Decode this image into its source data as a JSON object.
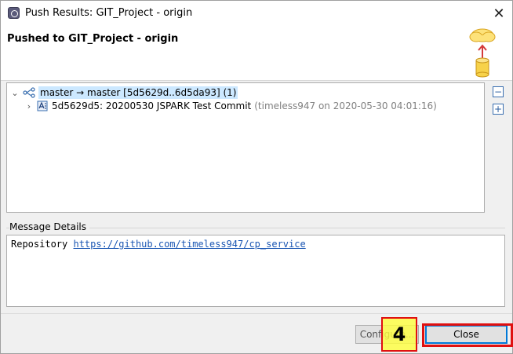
{
  "window": {
    "title": "Push Results: GIT_Project - origin",
    "close_glyph": "✕"
  },
  "header": {
    "title": "Pushed to GIT_Project - origin"
  },
  "tree": {
    "ref_row": {
      "label": "master → master [5d5629d..6d5da93] (1)",
      "expanded": true
    },
    "commit_row": {
      "label": "5d5629d5: 20200530 JSPARK Test Commit",
      "meta": "(timeless947 on 2020-05-30 04:01:16)"
    }
  },
  "side_buttons": {
    "collapse_glyph": "−",
    "expand_glyph": "+"
  },
  "message_details": {
    "label": "Message Details",
    "prefix": "Repository",
    "url": "https://github.com/timeless947/cp_service"
  },
  "buttons": {
    "configure": "Configure...",
    "close": "Close"
  },
  "annotation": {
    "step": "4"
  },
  "colors": {
    "selection": "#cce8ff",
    "link": "#1a56b3",
    "highlight_yellow": "#ffff3c",
    "highlight_red": "#e01010"
  },
  "icons": {
    "app": "eclipse-app-icon",
    "push_graphic": "cloud-upload-database-icon",
    "branch": "branch-ref-icon",
    "commit": "commit-icon"
  }
}
